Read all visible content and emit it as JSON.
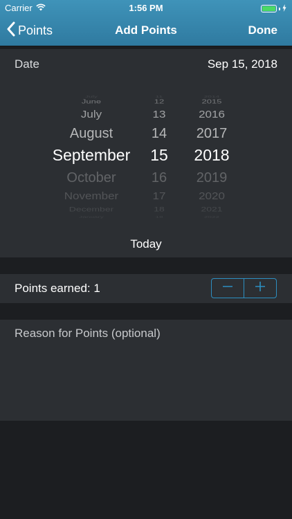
{
  "status_bar": {
    "carrier": "Carrier",
    "time": "1:56 PM",
    "battery_color": "#4cd964"
  },
  "nav": {
    "back_label": "Points",
    "title": "Add Points",
    "done_label": "Done"
  },
  "date": {
    "label": "Date",
    "value": "Sep 15, 2018"
  },
  "picker": {
    "months": [
      "July",
      "June",
      "July",
      "August",
      "September",
      "October",
      "November",
      "December",
      "January"
    ],
    "days": [
      "11",
      "12",
      "13",
      "14",
      "15",
      "16",
      "17",
      "18",
      "19"
    ],
    "years": [
      "2014",
      "2015",
      "2016",
      "2017",
      "2018",
      "2019",
      "2020",
      "2021",
      "2022"
    ],
    "selected": {
      "month": "September",
      "day": "15",
      "year": "2018"
    },
    "today_label": "Today"
  },
  "points": {
    "label": "Points earned: 1",
    "minus_symbol": "−",
    "plus_symbol": "+"
  },
  "reason": {
    "placeholder": "Reason for Points (optional)",
    "value": ""
  },
  "colors": {
    "nav_bar": "#3a8db5",
    "accent": "#2d8fc2",
    "background": "#1c1e21",
    "section": "#2c2f33"
  },
  "icons": {
    "wifi": "wifi-icon",
    "battery": "battery-icon",
    "charging": "charging-bolt-icon",
    "back": "chevron-left-icon",
    "minus": "minus-icon",
    "plus": "plus-icon"
  }
}
